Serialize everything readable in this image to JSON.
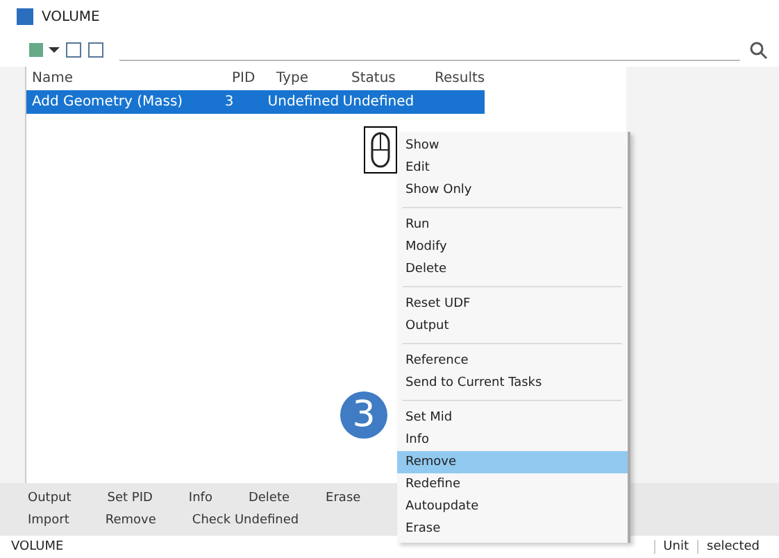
{
  "window": {
    "title": "VOLUME"
  },
  "table": {
    "columns": [
      "Name",
      "PID",
      "Type",
      "Status",
      "Results"
    ],
    "rows": [
      {
        "cells": [
          "Add Geometry (Mass)",
          "3",
          "Undefined",
          "Undefined",
          ""
        ],
        "selected": true
      }
    ]
  },
  "context_menu": {
    "groups": [
      [
        {
          "label": "Show",
          "selected": false
        },
        {
          "label": "Edit",
          "selected": false
        },
        {
          "label": "Show Only",
          "selected": false
        }
      ],
      [
        {
          "label": "Run",
          "selected": false
        },
        {
          "label": "Modify",
          "selected": false
        },
        {
          "label": "Delete",
          "selected": false
        }
      ],
      [
        {
          "label": "Reset UDF",
          "selected": false
        },
        {
          "label": "Output",
          "selected": false
        }
      ],
      [
        {
          "label": "Reference",
          "selected": false
        },
        {
          "label": "Send to Current Tasks",
          "selected": false
        }
      ],
      [
        {
          "label": "Set Mid",
          "selected": false
        },
        {
          "label": "Info",
          "selected": false
        },
        {
          "label": "Remove",
          "selected": true
        },
        {
          "label": "Redefine",
          "selected": false
        },
        {
          "label": "Autoupdate",
          "selected": false
        },
        {
          "label": "Erase",
          "selected": false
        }
      ]
    ]
  },
  "step_badge": "3",
  "button_rows": [
    [
      "Output",
      "Set PID",
      "Info",
      "Delete",
      "Erase"
    ],
    [
      "Import",
      "Remove",
      "Check Undefined"
    ]
  ],
  "status_bar": {
    "left": "VOLUME",
    "right": [
      "Unit",
      "selected"
    ]
  }
}
